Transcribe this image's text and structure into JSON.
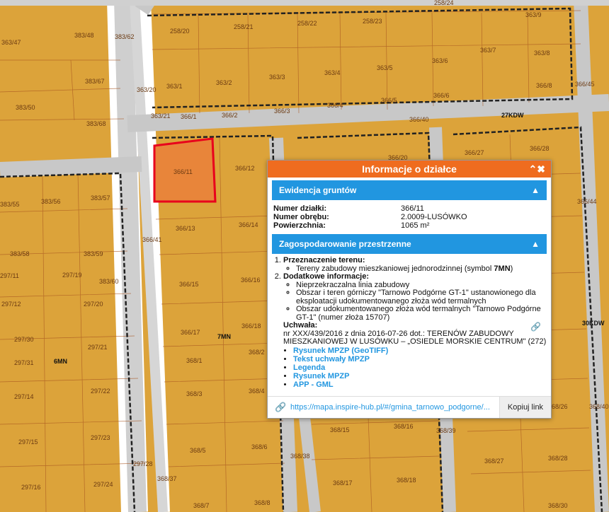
{
  "map": {
    "parcels": [
      "363/47",
      "383/48",
      "383/62",
      "383/67",
      "383/50",
      "383/68",
      "363/20",
      "363/21",
      "363/1",
      "363/2",
      "363/3",
      "363/4",
      "363/5",
      "363/6",
      "363/7",
      "363/8",
      "363/9",
      "366/1",
      "366/2",
      "366/3",
      "366/4",
      "366/5",
      "366/6",
      "366/8",
      "366/40",
      "366/45",
      "258/20",
      "258/21",
      "258/22",
      "258/23",
      "258/24",
      "366/11",
      "366/12",
      "366/13",
      "366/14",
      "366/15",
      "366/16",
      "366/17",
      "366/18",
      "366/41",
      "368/1",
      "368/2",
      "368/3",
      "368/4",
      "368/5",
      "368/6",
      "368/37",
      "368/7",
      "368/8",
      "368/38",
      "368/15",
      "368/16",
      "368/17",
      "368/18",
      "368/39",
      "368/26",
      "368/27",
      "368/28",
      "368/30",
      "366/27",
      "366/28",
      "366/20",
      "366/44",
      "383/55",
      "383/56",
      "383/57",
      "383/58",
      "383/59",
      "383/60",
      "297/11",
      "297/19",
      "297/12",
      "297/20",
      "297/30",
      "297/21",
      "297/31",
      "297/14",
      "297/22",
      "297/15",
      "297/23",
      "297/16",
      "297/24",
      "297/28",
      "368/40"
    ],
    "zone_labels": [
      "7MN",
      "6MN",
      "27KDW",
      "30KDW"
    ]
  },
  "popup": {
    "title": "Informacje o działce",
    "title_controls": "⌃✖",
    "ewidencja": {
      "heading": "Ewidencja gruntów",
      "rows": [
        {
          "key": "Numer działki:",
          "value": "366/11"
        },
        {
          "key": "Numer obrębu:",
          "value": "2.0009-LUSÓWKO"
        },
        {
          "key": "Powierzchnia:",
          "value": "1065 m²"
        }
      ]
    },
    "zagospodarowanie": {
      "heading": "Zagospodarowanie przestrzenne",
      "item1_title": "Przeznaczenie terenu:",
      "item1_text_pre": "Tereny zabudowy mieszkaniowej jednorodzinnej (symbol ",
      "item1_symbol": "7MN",
      "item1_text_post": ")",
      "item2_title": "Dodatkowe informacje:",
      "item2_bullets": [
        "Nieprzekraczalna linia zabudowy",
        "Obszar i teren górniczy \"Tarnowo Podgórne GT-1\" ustanowionego dla eksploatacji udokumentowanego złoża wód termalnych",
        "Obszar udokumentowanego złoża wód termalnych \"Tarnowo Podgórne GT-1\" (numer złoża 15707)"
      ],
      "uchwala_label": "Uchwała:",
      "uchwala_text": "nr XXX/439/2016 z dnia 2016-07-26 dot.: TERENÓW ZABUDOWY MIESZKANIOWEJ W LUSÓWKU – „OSIEDLE MORSKIE CENTRUM\" (272)",
      "links": [
        "Rysunek MPZP (GeoTIFF)",
        "Tekst uchwały MPZP",
        "Legenda",
        "Rysunek MPZP",
        "APP - GML"
      ]
    },
    "footer": {
      "url": "https://mapa.inspire-hub.pl/#/gmina_tarnowo_podgorne/...",
      "copy_label": "Kopiuj link"
    }
  },
  "colors": {
    "zone": "#dca33a",
    "road": "#c8c8c8",
    "selection": "#e8001c",
    "popup_header": "#ef6c1f",
    "section": "#2196e0"
  }
}
